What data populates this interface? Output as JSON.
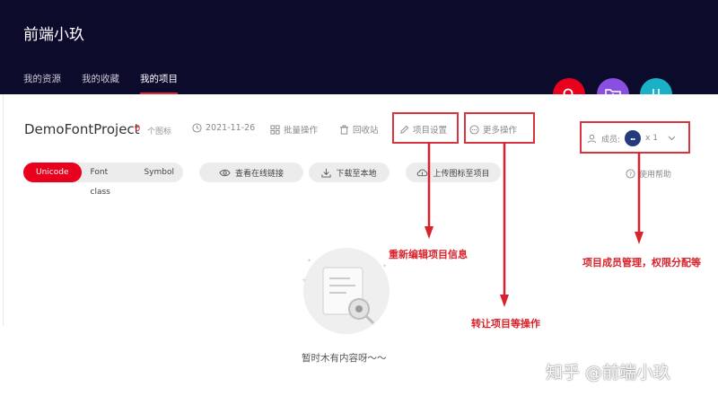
{
  "header": {
    "brand": "前端小玖",
    "nav": [
      "我的资源",
      "我的收藏",
      "我的项目"
    ],
    "active_nav": "我的项目"
  },
  "fabs": {
    "search_color": "#e8001c",
    "folder_color": "#8a4fe0",
    "sort_color": "#1ab0c8"
  },
  "project": {
    "title": "DemoFontProject",
    "icon_count": "0",
    "icon_count_unit": "个图标",
    "date": "2021-11-26",
    "batch_label": "批量操作",
    "recycle_label": "回收站",
    "settings_label": "项目设置",
    "more_label": "更多操作",
    "members_label": "成员:",
    "members_count": "x 1",
    "help_label": "使用帮助"
  },
  "tabs": [
    "Unicode",
    "Font class",
    "Symbol"
  ],
  "actions": {
    "view_online": "查看在线链接",
    "download": "下载至本地",
    "upload": "上传图标至项目"
  },
  "empty_text": "暂时木有内容呀～～",
  "annotations": {
    "edit_info": "重新编辑项目信息",
    "transfer": "转让项目等操作",
    "members_mgmt": "项目成员管理，权限分配等"
  },
  "watermark": "知乎 @前端小玖"
}
